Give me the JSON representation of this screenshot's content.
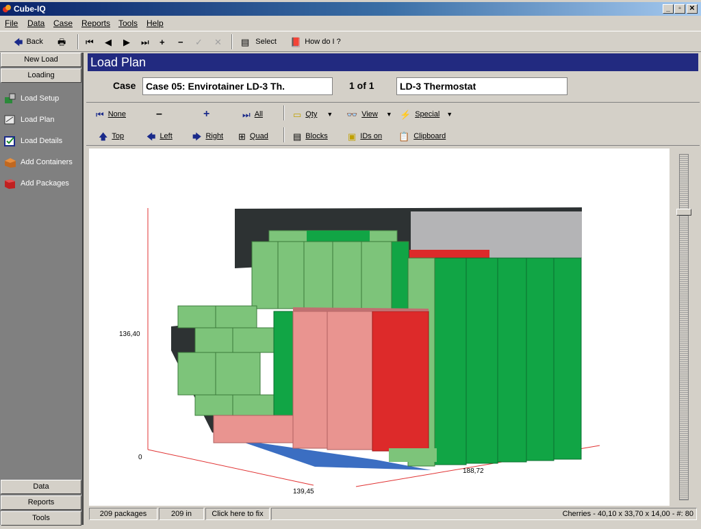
{
  "window": {
    "title": "Cube-IQ"
  },
  "menu": [
    "File",
    "Data",
    "Case",
    "Reports",
    "Tools",
    "Help"
  ],
  "toolbar": {
    "back": "Back",
    "select": "Select",
    "howdoi": "How do I ?"
  },
  "sidebar": {
    "top_buttons": [
      "New Load",
      "Loading"
    ],
    "items": [
      {
        "label": "Load Setup",
        "icon": "load-setup-icon"
      },
      {
        "label": "Load Plan",
        "icon": "load-plan-icon"
      },
      {
        "label": "Load Details",
        "icon": "load-details-icon"
      },
      {
        "label": "Add Containers",
        "icon": "add-containers-icon"
      },
      {
        "label": "Add Packages",
        "icon": "add-packages-icon"
      }
    ],
    "bottom_buttons": [
      "Data",
      "Reports",
      "Tools"
    ]
  },
  "main": {
    "header": "Load Plan",
    "case_label": "Case",
    "case_value": "Case 05: Envirotainer LD-3 Th.",
    "pager": "1 of 1",
    "container_value": "LD-3 Thermostat"
  },
  "view_toolbar": {
    "row1": [
      "None",
      "–",
      "+",
      "All",
      "Qty",
      "View",
      "Special"
    ],
    "row2": [
      "Top",
      "Left",
      "Right",
      "Quad",
      "Blocks",
      "IDs on",
      "Clipboard"
    ]
  },
  "plot": {
    "height_label": "136,40",
    "origin_label": "0",
    "depth_label": "139,45",
    "length_label": "188,72"
  },
  "status": {
    "packages": "209 packages",
    "count_in": "209 in",
    "fix": "Click here to fix",
    "info": "Cherries -   40,10 x 33,70 x 14,00 - #: 80"
  },
  "colors": {
    "header_bg": "#222a80",
    "green_light": "#7dc47a",
    "green_dark": "#11a545",
    "pink": "#e99490",
    "red": "#dd2a2a",
    "gray_wall": "#b4b4b6",
    "floor_blue": "#3b6ec2"
  }
}
